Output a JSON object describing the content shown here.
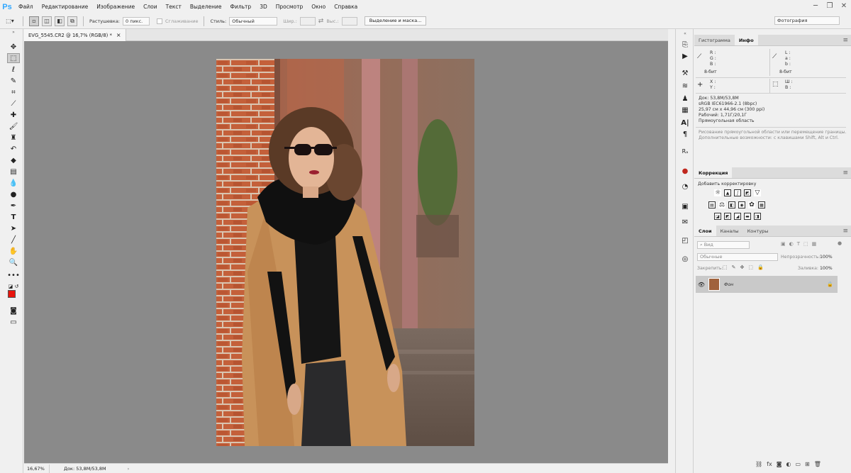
{
  "app": {
    "logo": "Ps"
  },
  "menu": [
    "Файл",
    "Редактирование",
    "Изображение",
    "Слои",
    "Текст",
    "Выделение",
    "Фильтр",
    "3D",
    "Просмотр",
    "Окно",
    "Справка"
  ],
  "window_controls": {
    "minimize": "─",
    "restore": "❐",
    "close": "✕"
  },
  "options": {
    "feather_label": "Растушевка:",
    "feather_value": "0 пикс.",
    "antialias_label": "Сглаживание",
    "style_label": "Стиль:",
    "style_value": "Обычный",
    "width_label": "Шир.:",
    "height_label": "Выс.:",
    "select_mask_button": "Выделение и маска...",
    "workspace": "Фотография"
  },
  "document": {
    "tab_title": "EVG_5545.CR2 @ 16,7% (RGB/8) *",
    "tab_close": "×",
    "zoom": "16,67%",
    "doc_size": "Док: 53,8M/53,8M",
    "status_arrow": "›"
  },
  "info_panel": {
    "tabs": [
      "Гистограмма",
      "Инфо"
    ],
    "active_tab": "Инфо",
    "left_channels": [
      "R :",
      "G :",
      "B :"
    ],
    "right_channels": [
      "L :",
      "a :",
      "b :"
    ],
    "left_bits": "8-бит",
    "right_bits": "8-бит",
    "xy": [
      "X :",
      "Y :"
    ],
    "wh": [
      "Ш :",
      "В :"
    ],
    "doc_lines": [
      "Док: 53,8M/53,8M",
      "sRGB IEC61966-2.1 (8bpc)",
      "25,97 см x 44,96 см (300 ppi)",
      "Рабочий: 1,71Г/20,1Г",
      "Прямоугольная область"
    ],
    "hint_lines": [
      "Рисование прямоугольной области или перемещение границы.",
      "Дополнительные возможности: с клавишами Shift, Alt и Ctrl."
    ]
  },
  "correction_panel": {
    "title": "Коррекция",
    "subtitle": "Добавить корректировку"
  },
  "layers_panel": {
    "tabs": [
      "Слои",
      "Каналы",
      "Контуры"
    ],
    "active_tab": "Слои",
    "filter_placeholder": "Вид",
    "blend_mode": "Обычные",
    "opacity_label": "Непрозрачность:",
    "opacity_value": "100%",
    "lock_label": "Закрепить:",
    "fill_label": "Заливка:",
    "fill_value": "100%",
    "layers": [
      {
        "name": "Фон",
        "visible": true,
        "locked": true
      }
    ]
  },
  "colors": {
    "foreground": "#e8140c",
    "background": "#ffffff",
    "canvas_bg": "#8a8a8a",
    "ps_blue": "#31a8ff"
  }
}
